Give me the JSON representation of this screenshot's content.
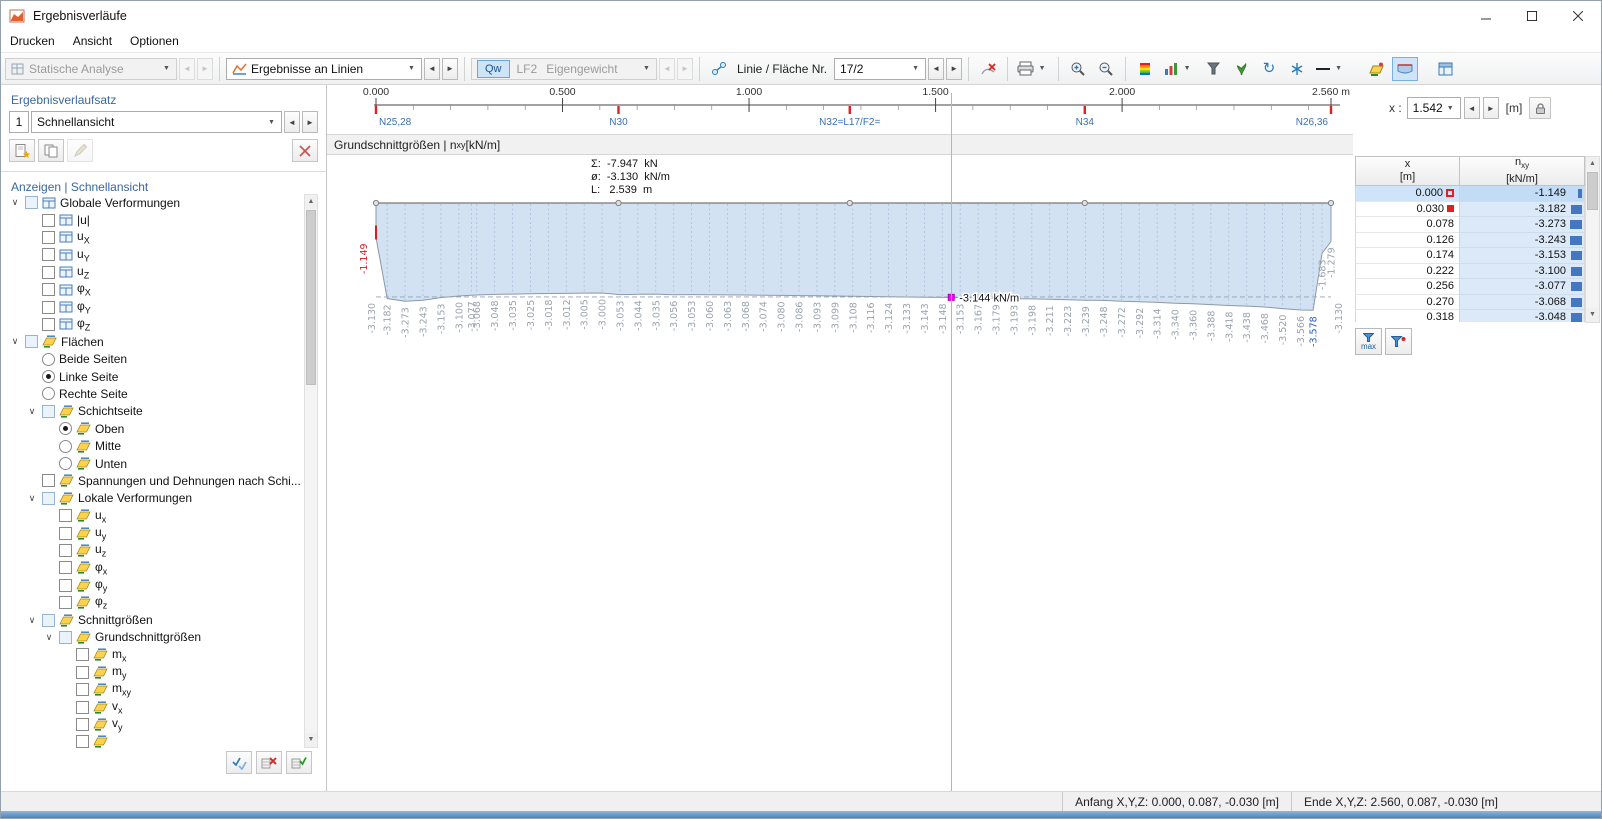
{
  "window": {
    "title": "Ergebnisverläufe"
  },
  "menu": {
    "items": [
      "Drucken",
      "Ansicht",
      "Optionen"
    ]
  },
  "toolbar": {
    "analysis": "Statische Analyse",
    "results_type": "Ergebnisse an Linien",
    "qw": "Qw",
    "loadcase_id": "LF2",
    "loadcase_name": "Eigengewicht",
    "line_label": "Linie / Fläche Nr.",
    "line_value": "17/2",
    "icons": [
      "print",
      "zoom-in",
      "zoom-out",
      "color-scale",
      "diagram-style",
      "filter",
      "smoothing",
      "refresh",
      "extremes",
      "line-style",
      "result-values",
      "result-diagram",
      "result-table"
    ]
  },
  "sidebar": {
    "set_header": "Ergebnisverlaufsatz",
    "set_number": "1",
    "set_name": "Schnellansicht",
    "view_header": "Anzeigen | Schnellansicht",
    "tree": [
      {
        "level": 0,
        "expander": true,
        "control": "checkbox",
        "group": true,
        "icon": "window",
        "text": "Globale Verformungen"
      },
      {
        "level": 1,
        "control": "checkbox",
        "icon": "window",
        "text": "|u|"
      },
      {
        "level": 1,
        "control": "checkbox",
        "icon": "window",
        "text": "u",
        "sub": "X"
      },
      {
        "level": 1,
        "control": "checkbox",
        "icon": "window",
        "text": "u",
        "sub": "Y"
      },
      {
        "level": 1,
        "control": "checkbox",
        "icon": "window",
        "text": "u",
        "sub": "Z"
      },
      {
        "level": 1,
        "control": "checkbox",
        "icon": "window",
        "text": "φ",
        "sub": "X"
      },
      {
        "level": 1,
        "control": "checkbox",
        "icon": "window",
        "text": "φ",
        "sub": "Y"
      },
      {
        "level": 1,
        "control": "checkbox",
        "icon": "window",
        "text": "φ",
        "sub": "Z"
      },
      {
        "level": 0,
        "expander": true,
        "control": "checkbox",
        "group": true,
        "icon": "surface",
        "text": "Flächen"
      },
      {
        "level": 1,
        "control": "radio",
        "text": "Beide Seiten"
      },
      {
        "level": 1,
        "control": "radio",
        "selected": true,
        "text": "Linke Seite"
      },
      {
        "level": 1,
        "control": "radio",
        "text": "Rechte Seite"
      },
      {
        "level": 1,
        "expander": true,
        "control": "checkbox",
        "group": true,
        "icon": "surface",
        "text": "Schichtseite"
      },
      {
        "level": 2,
        "control": "radio",
        "selected": true,
        "icon": "surface",
        "text": "Oben"
      },
      {
        "level": 2,
        "control": "radio",
        "icon": "surface",
        "text": "Mitte"
      },
      {
        "level": 2,
        "control": "radio",
        "icon": "surface",
        "text": "Unten"
      },
      {
        "level": 1,
        "control": "checkbox",
        "icon": "surface",
        "text": "Spannungen und Dehnungen nach Schi..."
      },
      {
        "level": 1,
        "expander": true,
        "control": "checkbox",
        "group": true,
        "icon": "surface",
        "text": "Lokale Verformungen"
      },
      {
        "level": 2,
        "control": "checkbox",
        "icon": "surface",
        "text": "u",
        "sub": "x"
      },
      {
        "level": 2,
        "control": "checkbox",
        "icon": "surface",
        "text": "u",
        "sub": "y"
      },
      {
        "level": 2,
        "control": "checkbox",
        "icon": "surface",
        "text": "u",
        "sub": "z"
      },
      {
        "level": 2,
        "control": "checkbox",
        "icon": "surface",
        "text": "φ",
        "sub": "x"
      },
      {
        "level": 2,
        "control": "checkbox",
        "icon": "surface",
        "text": "φ",
        "sub": "y"
      },
      {
        "level": 2,
        "control": "checkbox",
        "icon": "surface",
        "text": "φ",
        "sub": "z"
      },
      {
        "level": 1,
        "expander": true,
        "control": "checkbox",
        "group": true,
        "icon": "surface",
        "text": "Schnittgrößen"
      },
      {
        "level": 2,
        "expander": true,
        "control": "checkbox",
        "group": true,
        "icon": "surface",
        "text": "Grundschnittgrößen"
      },
      {
        "level": 3,
        "control": "checkbox",
        "icon": "surface",
        "text": "m",
        "sub": "x"
      },
      {
        "level": 3,
        "control": "checkbox",
        "icon": "surface",
        "text": "m",
        "sub": "y"
      },
      {
        "level": 3,
        "control": "checkbox",
        "icon": "surface",
        "text": "m",
        "sub": "xy"
      },
      {
        "level": 3,
        "control": "checkbox",
        "icon": "surface",
        "text": "v",
        "sub": "x"
      },
      {
        "level": 3,
        "control": "checkbox",
        "icon": "surface",
        "text": "v",
        "sub": "y"
      },
      {
        "level": 3,
        "control": "checkbox",
        "icon": "surface",
        "text": ""
      }
    ]
  },
  "ruler": {
    "ticks": [
      {
        "x": 0.0,
        "label": "0.000"
      },
      {
        "x": 0.5,
        "label": "0.500"
      },
      {
        "x": 1.0,
        "label": "1.000"
      },
      {
        "x": 1.5,
        "label": "1.500"
      },
      {
        "x": 2.0,
        "label": "2.000"
      },
      {
        "x": 2.56,
        "label": "2.560 m"
      }
    ],
    "nodes": [
      {
        "x": 0.0,
        "label": "N25,28"
      },
      {
        "x": 0.65,
        "label": "N30"
      },
      {
        "x": 1.27,
        "label": "N32=L17/F2="
      },
      {
        "x": 1.9,
        "label": "N34"
      },
      {
        "x": 2.56,
        "label": "N26,36"
      }
    ],
    "x_label": "x :",
    "x_value": "1.542",
    "x_unit": "[m]"
  },
  "chart_header": {
    "prefix": "Grundschnittgrößen | n",
    "sub": "xy",
    "suffix": " [kN/m]"
  },
  "chart_data": {
    "type": "area",
    "title": "Grundschnittgrößen | nxy [kN/m]",
    "xlabel": "x [m]",
    "ylabel": "nxy [kN/m]",
    "x_range": [
      0,
      2.56
    ],
    "baseline": 0,
    "average": -3.13,
    "average_label": "-3.130",
    "stats": {
      "sum": "Σ:  -7.947  kN",
      "mean": "ø:  -3.130  kN/m",
      "length": "L:   2.539  m"
    },
    "cursor": {
      "x": 1.542,
      "value": -3.144,
      "label": "-3.144 kN/m"
    },
    "points": [
      [
        0.0,
        -1.149,
        "max"
      ],
      [
        0.03,
        -3.182
      ],
      [
        0.078,
        -3.273
      ],
      [
        0.126,
        -3.243
      ],
      [
        0.174,
        -3.153
      ],
      [
        0.222,
        -3.1
      ],
      [
        0.256,
        -3.077
      ],
      [
        0.27,
        -3.068
      ],
      [
        0.318,
        -3.048
      ],
      [
        0.366,
        -3.035
      ],
      [
        0.414,
        -3.025
      ],
      [
        0.462,
        -3.018
      ],
      [
        0.51,
        -3.012
      ],
      [
        0.558,
        -3.005
      ],
      [
        0.606,
        -3.0
      ],
      [
        0.654,
        -3.053
      ],
      [
        0.702,
        -3.044
      ],
      [
        0.75,
        -3.035
      ],
      [
        0.798,
        -3.056
      ],
      [
        0.846,
        -3.053
      ],
      [
        0.894,
        -3.06
      ],
      [
        0.942,
        -3.063
      ],
      [
        0.99,
        -3.068
      ],
      [
        1.038,
        -3.074
      ],
      [
        1.086,
        -3.08
      ],
      [
        1.134,
        -3.086
      ],
      [
        1.182,
        -3.093
      ],
      [
        1.23,
        -3.099
      ],
      [
        1.278,
        -3.108
      ],
      [
        1.326,
        -3.116
      ],
      [
        1.374,
        -3.124
      ],
      [
        1.422,
        -3.133
      ],
      [
        1.47,
        -3.143
      ],
      [
        1.518,
        -3.148
      ],
      [
        1.566,
        -3.153
      ],
      [
        1.614,
        -3.167
      ],
      [
        1.662,
        -3.179
      ],
      [
        1.71,
        -3.193
      ],
      [
        1.758,
        -3.198
      ],
      [
        1.806,
        -3.211
      ],
      [
        1.854,
        -3.223
      ],
      [
        1.902,
        -3.239
      ],
      [
        1.95,
        -3.248
      ],
      [
        1.998,
        -3.272
      ],
      [
        2.046,
        -3.292
      ],
      [
        2.094,
        -3.314
      ],
      [
        2.142,
        -3.34
      ],
      [
        2.19,
        -3.36
      ],
      [
        2.238,
        -3.388
      ],
      [
        2.286,
        -3.418
      ],
      [
        2.334,
        -3.438
      ],
      [
        2.382,
        -3.468
      ],
      [
        2.43,
        -3.52
      ],
      [
        2.478,
        -3.566
      ],
      [
        2.512,
        -3.578,
        "min"
      ],
      [
        2.536,
        -1.683
      ],
      [
        2.56,
        -1.279
      ]
    ]
  },
  "table": {
    "col_x": {
      "name": "x",
      "unit": "[m]"
    },
    "col_n": {
      "name": "n",
      "sub": "xy",
      "unit": "[kN/m]"
    },
    "filter_max": "max",
    "rows": [
      {
        "x": "0.000",
        "value": "-1.149",
        "marker": "flag",
        "selected": true
      },
      {
        "x": "0.030",
        "value": "-3.182",
        "marker": "square"
      },
      {
        "x": "0.078",
        "value": "-3.273"
      },
      {
        "x": "0.126",
        "value": "-3.243"
      },
      {
        "x": "0.174",
        "value": "-3.153"
      },
      {
        "x": "0.222",
        "value": "-3.100"
      },
      {
        "x": "0.256",
        "value": "-3.077"
      },
      {
        "x": "0.270",
        "value": "-3.068"
      },
      {
        "x": "0.318",
        "value": "-3.048"
      }
    ]
  },
  "status": {
    "start": "Anfang X,Y,Z: 0.000, 0.087, -0.030 [m]",
    "end": "Ende X,Y,Z: 2.560, 0.087, -0.030 [m]"
  },
  "colors": {
    "accent": "#2a6eb5",
    "fill": "#cfdff2",
    "max": "#cc2222",
    "min": "#2a5fc0",
    "cursor": "#ff00ff",
    "bar": "#4576c2"
  }
}
